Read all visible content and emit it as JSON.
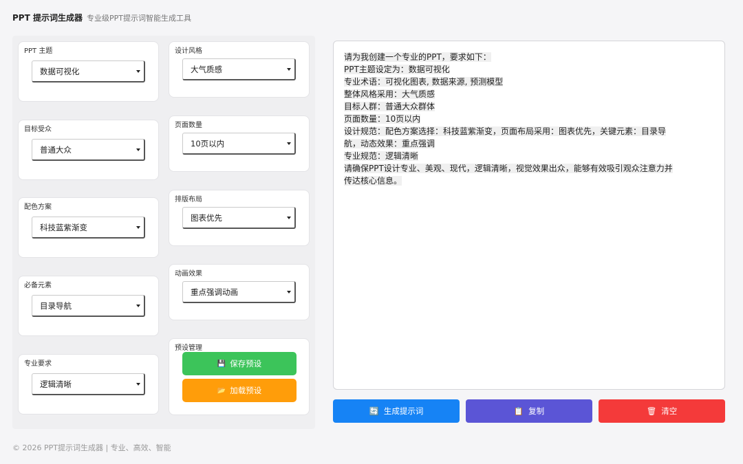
{
  "header": {
    "title": "PPT 提示词生成器",
    "subtitle": "专业级PPT提示词智能生成工具"
  },
  "fields": {
    "theme": {
      "label": "PPT 主题",
      "value": "数据可视化"
    },
    "audience": {
      "label": "目标受众",
      "value": "普通大众"
    },
    "color": {
      "label": "配色方案",
      "value": "科技蓝紫渐变"
    },
    "elements": {
      "label": "必备元素",
      "value": "目录导航"
    },
    "requirement": {
      "label": "专业要求",
      "value": "逻辑清晰"
    },
    "style": {
      "label": "设计风格",
      "value": "大气质感"
    },
    "pages": {
      "label": "页面数量",
      "value": "10页以内"
    },
    "layout": {
      "label": "排版布局",
      "value": "图表优先"
    },
    "animation": {
      "label": "动画效果",
      "value": "重点强调动画"
    }
  },
  "preset": {
    "label": "预设管理",
    "save_label": "保存预设",
    "save_icon": "floppy-icon",
    "load_label": "加载预设",
    "load_icon": "folder-icon"
  },
  "output": {
    "lines": [
      "请为我创建一个专业的PPT，要求如下：",
      "PPT主题设定为：数据可视化",
      "专业术语：可视化图表, 数据来源, 预测模型",
      "整体风格采用：大气质感",
      "目标人群：普通大众群体",
      "页面数量：10页以内",
      "设计规范：配色方案选择：科技蓝紫渐变，页面布局采用：图表优先，关键元素：目录导",
      "航，动态效果：重点强调",
      "专业规范：逻辑清晰",
      "请确保PPT设计专业、美观、现代，逻辑清晰，视觉效果出众，能够有效吸引观众注意力并",
      "传达核心信息。"
    ]
  },
  "actions": {
    "generate_label": "生成提示词",
    "copy_label": "复制",
    "clear_label": "清空"
  },
  "colors": {
    "generate": "#1683f5",
    "copy": "#5b55d6",
    "clear": "#f43a3a",
    "save": "#3cc45a",
    "load": "#ff9d0a"
  },
  "footer": {
    "text": "© 2026 PPT提示词生成器 | 专业、高效、智能"
  }
}
